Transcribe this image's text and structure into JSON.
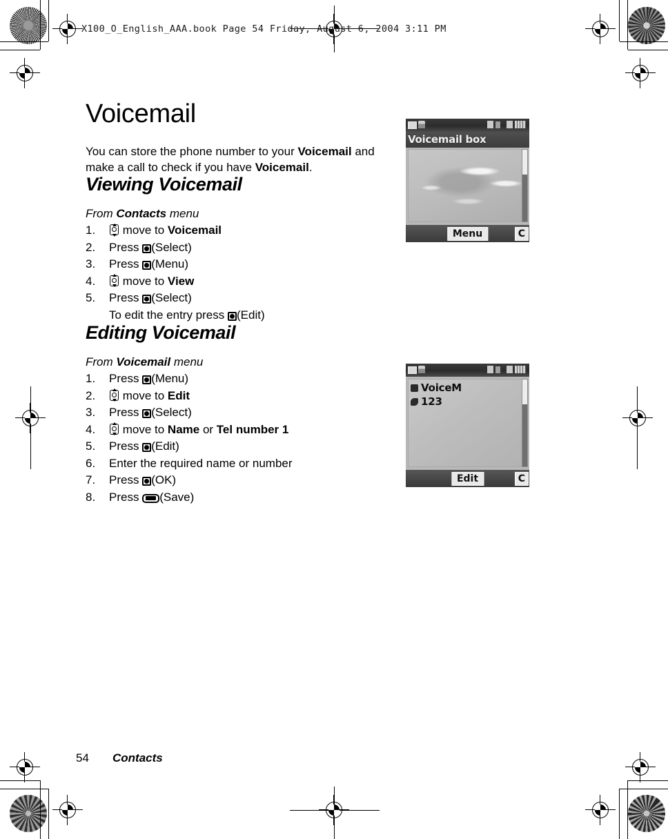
{
  "book_header": "X100_O_English_AAA.book  Page 54  Friday, August 6, 2004  3:11 PM",
  "page": {
    "title": "Voicemail",
    "intro_part1": "You can store the phone number to your ",
    "intro_bold1": "Voicemail",
    "intro_part2": " and make a call to check if you have ",
    "intro_bold2": "Voicemail",
    "intro_part3": "."
  },
  "sections": [
    {
      "heading": "Viewing Voicemail",
      "from_prefix": "From ",
      "from_bold": "Contacts",
      "from_suffix": " menu",
      "steps": [
        {
          "num": "1.",
          "key": "nav",
          "text_before": " move to ",
          "bold": "Voicemail",
          "text_after": ""
        },
        {
          "num": "2.",
          "key": "center",
          "text_before": "Press ",
          "bold": "",
          "text_after": "(Select)"
        },
        {
          "num": "3.",
          "key": "center",
          "text_before": "Press ",
          "bold": "",
          "text_after": "(Menu)"
        },
        {
          "num": "4.",
          "key": "nav",
          "text_before": " move to ",
          "bold": "View",
          "text_after": ""
        },
        {
          "num": "5.",
          "key": "center",
          "text_before": "Press ",
          "bold": "",
          "text_after": "(Select)"
        }
      ],
      "substep": {
        "text_before": "To edit the entry press ",
        "key": "center",
        "text_after": "(Edit)"
      }
    },
    {
      "heading": "Editing Voicemail",
      "from_prefix": "From ",
      "from_bold": "Voicemail",
      "from_suffix": " menu",
      "steps": [
        {
          "num": "1.",
          "key": "center",
          "text_before": "Press ",
          "bold": "",
          "text_after": "(Menu)"
        },
        {
          "num": "2.",
          "key": "nav",
          "text_before": " move to ",
          "bold": "Edit",
          "text_after": ""
        },
        {
          "num": "3.",
          "key": "center",
          "text_before": "Press ",
          "bold": "",
          "text_after": "(Select)"
        },
        {
          "num": "4.",
          "key": "nav",
          "text_before": " move to ",
          "bold": "Name",
          "text_mid": " or ",
          "bold2": "Tel number 1",
          "text_after": ""
        },
        {
          "num": "5.",
          "key": "center",
          "text_before": "Press ",
          "bold": "",
          "text_after": "(Edit)"
        },
        {
          "num": "6.",
          "key": "none",
          "text_before": "Enter the required name or number",
          "bold": "",
          "text_after": ""
        },
        {
          "num": "7.",
          "key": "center",
          "text_before": "Press ",
          "bold": "",
          "text_after": "(OK)"
        },
        {
          "num": "8.",
          "key": "soft",
          "text_before": "Press ",
          "bold": "",
          "text_after": "(Save)"
        }
      ]
    }
  ],
  "screenshots": [
    {
      "name": "voicemail-box-screen",
      "title": "Voicemail box",
      "softkey_center": "Menu",
      "softkey_right": "C",
      "entries": []
    },
    {
      "name": "voicemail-entry-screen",
      "title": "",
      "softkey_center": "Edit",
      "softkey_right": "C",
      "entries": [
        "VoiceM",
        "123"
      ]
    }
  ],
  "footer": {
    "page_number": "54",
    "chapter": "Contacts"
  },
  "colors": {
    "ink": "#000000",
    "paper": "#ffffff",
    "screen_bg": "#b8b8b8",
    "screen_chrome": "#3a3a3a"
  }
}
